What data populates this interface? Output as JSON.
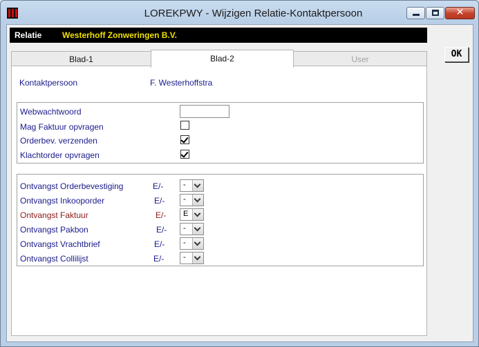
{
  "window": {
    "title": "LOREKPWY - Wijzigen Relatie-Kontaktpersoon",
    "close_glyph": "✕"
  },
  "relatie": {
    "label": "Relatie",
    "value": "Westerhoff Zonweringen B.V."
  },
  "ok_button": {
    "label": "OK"
  },
  "tabs": [
    {
      "label": "Blad-1",
      "state": "normal"
    },
    {
      "label": "Blad-2",
      "state": "selected"
    },
    {
      "label": "User",
      "state": "disabled"
    }
  ],
  "contact": {
    "label": "Kontaktpersoon",
    "value": "F. Westerhoffstra"
  },
  "settings": {
    "webwachtwoord_label": "Webwachtwoord",
    "webwachtwoord_value": "",
    "rows": [
      {
        "label": "Mag Faktuur opvragen",
        "checked": false
      },
      {
        "label": "Orderbev. verzenden",
        "checked": true
      },
      {
        "label": "Klachtorder opvragen",
        "checked": true
      }
    ]
  },
  "ontvangst": [
    {
      "label": "Ontvangst Orderbevestiging",
      "hint": "E/-",
      "value": "-",
      "color": "#1a1a8c"
    },
    {
      "label": "Ontvangst Inkooporder",
      "hint": "E/-",
      "value": "-",
      "color": "#1a1a8c"
    },
    {
      "label": "Ontvangst Faktuur",
      "hint": "E/-",
      "value": "E",
      "color": "#8b1a1a"
    },
    {
      "label": "Ontvangst Pakbon",
      "hint": "E/-",
      "value": "-",
      "color": "#1a1a8c"
    },
    {
      "label": "Ontvangst Vrachtbrief",
      "hint": "E/-",
      "value": "-",
      "color": "#1a1a8c"
    },
    {
      "label": "Ontvangst Collilijst",
      "hint": "E/-",
      "value": "-",
      "color": "#1a1a8c"
    }
  ]
}
